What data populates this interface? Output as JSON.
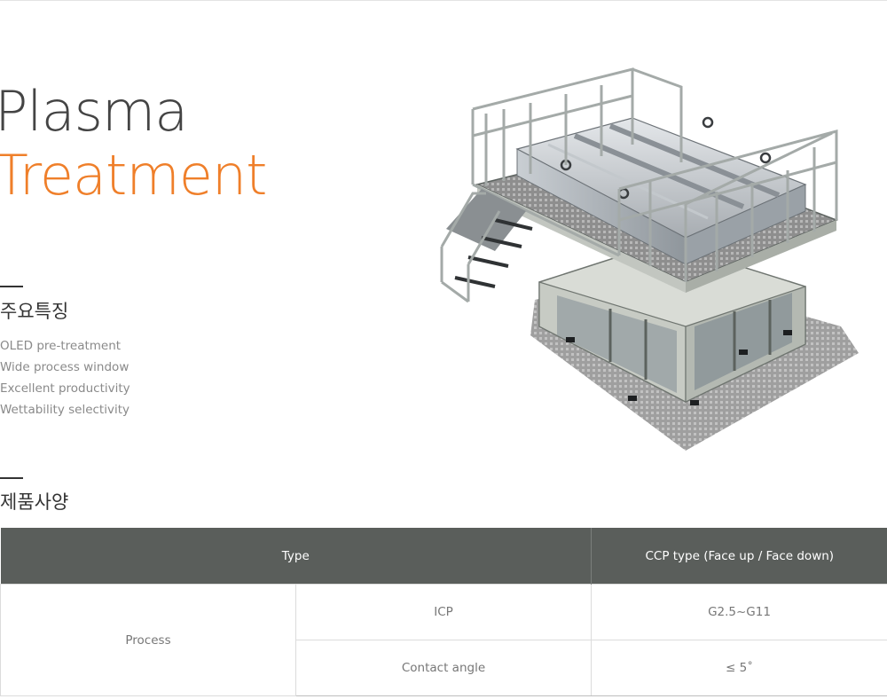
{
  "hero": {
    "title_line1": "Plasma",
    "title_line2": "Treatment",
    "accent_color": "#ef7f2a"
  },
  "features": {
    "heading": "주요특징",
    "items": [
      "OLED pre-treatment",
      "Wide process window",
      "Excellent productivity",
      "Wettability selectivity"
    ]
  },
  "specs": {
    "heading": "제품사양",
    "header_bg": "#5a5e5b",
    "columns": [
      "Type",
      "CCP type (Face up / Face down)"
    ],
    "group_label": "Process",
    "rows": [
      {
        "param": "ICP",
        "value": "G2.5~G11"
      },
      {
        "param": "Contact angle",
        "value": "≤ 5˚"
      }
    ]
  },
  "image": {
    "subject": "plasma-treatment-equipment",
    "icon": "machine-illustration"
  }
}
